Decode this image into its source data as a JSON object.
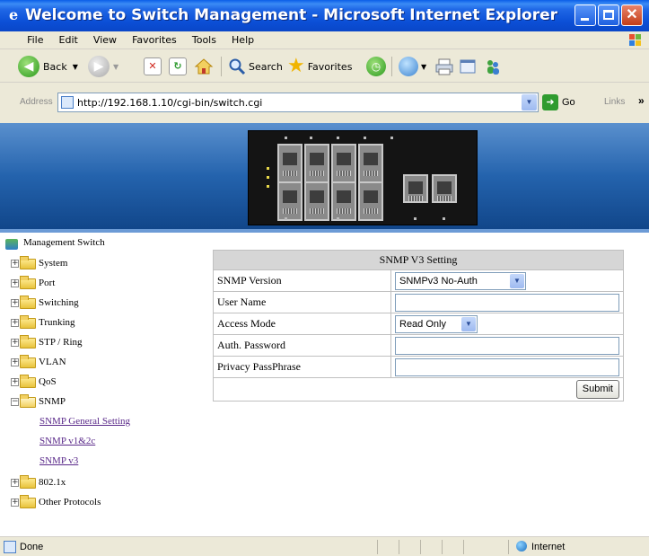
{
  "window": {
    "title": "Welcome to Switch Management - Microsoft Internet Explorer"
  },
  "menu": [
    "File",
    "Edit",
    "View",
    "Favorites",
    "Tools",
    "Help"
  ],
  "toolbar": {
    "back_label": "Back",
    "search_label": "Search",
    "favorites_label": "Favorites"
  },
  "address": {
    "label": "Address",
    "url": "http://192.168.1.10/cgi-bin/switch.cgi",
    "go_label": "Go",
    "links_label": "Links"
  },
  "tree": {
    "root": "Management Switch",
    "items": [
      "System",
      "Port",
      "Switching",
      "Trunking",
      "STP / Ring",
      "VLAN",
      "QoS",
      "SNMP"
    ],
    "snmp_children": [
      "SNMP General Setting",
      "SNMP v1&2c",
      "SNMP v3"
    ],
    "items_after": [
      "802.1x",
      "Other Protocols"
    ]
  },
  "form": {
    "title": "SNMP V3 Setting",
    "rows": {
      "version_label": "SNMP Version",
      "version_value": "SNMPv3 No-Auth",
      "user_label": "User Name",
      "user_value": "",
      "access_label": "Access Mode",
      "access_value": "Read Only",
      "auth_label": "Auth. Password",
      "auth_value": "",
      "privacy_label": "Privacy PassPhrase",
      "privacy_value": ""
    },
    "submit_label": "Submit"
  },
  "status": {
    "text": "Done",
    "zone": "Internet"
  }
}
